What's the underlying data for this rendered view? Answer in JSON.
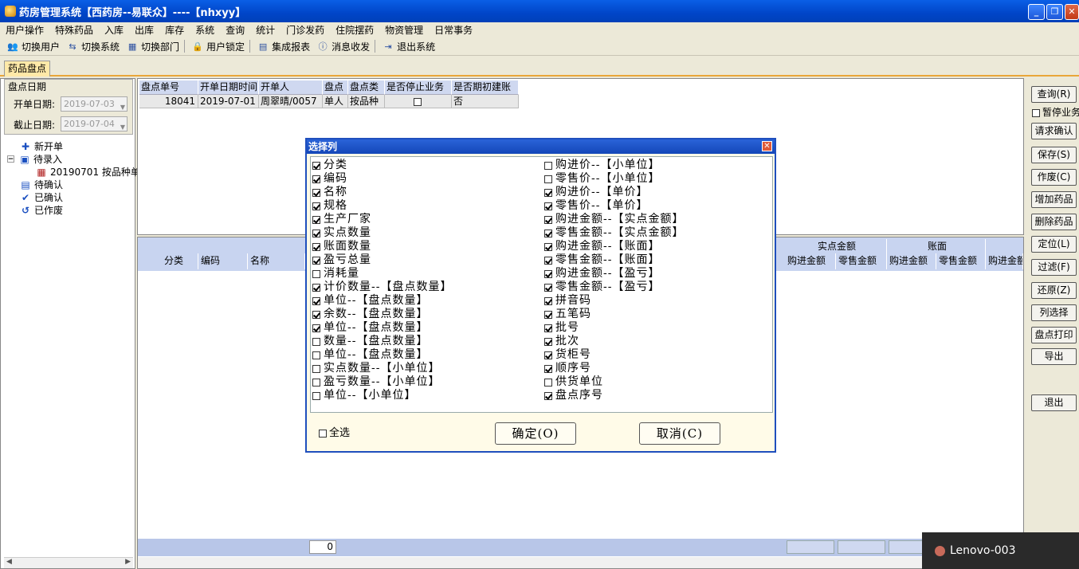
{
  "window": {
    "title": "药房管理系统【西药房--易联众】----【nhxyy】"
  },
  "menu": [
    "用户操作",
    "特殊药品",
    "入库",
    "出库",
    "库存",
    "系统",
    "查询",
    "统计",
    "门诊发药",
    "住院摆药",
    "物资管理",
    "日常事务"
  ],
  "toolbar": [
    {
      "label": "切换用户",
      "icon": "users-icon"
    },
    {
      "label": "切换系统",
      "icon": "switch-system-icon"
    },
    {
      "label": "切换部门",
      "icon": "department-icon"
    },
    {
      "label": "用户锁定",
      "icon": "user-lock-icon"
    },
    {
      "label": "集成报表",
      "icon": "report-icon"
    },
    {
      "label": "消息收发",
      "icon": "message-icon"
    },
    {
      "label": "退出系统",
      "icon": "exit-icon"
    }
  ],
  "tab": "药品盘点",
  "left": {
    "group_title": "盘点日期",
    "start_label": "开单日期:",
    "start_value": "2019-07-03",
    "end_label": "截止日期:",
    "end_value": "2019-07-04",
    "tree": [
      "新开单",
      "待录入",
      "20190701 按品种单",
      "待确认",
      "已确认",
      "已作废"
    ]
  },
  "grid1": {
    "headers": [
      "盘点单号",
      "开单日期时间",
      "开单人",
      "盘点",
      "盘点类",
      "是否停止业务",
      "是否期初建账"
    ],
    "row": [
      "18041",
      "2019-07-01",
      "周翠晴/0057",
      "单人",
      "按品种",
      "",
      "否"
    ]
  },
  "grid2": {
    "headers": [
      "分类",
      "编码",
      "名称"
    ],
    "group_headers": [
      "实点金额",
      "账面"
    ],
    "sub_headers": [
      "购进金额",
      "零售金额",
      "购进金额",
      "零售金额",
      "购进金额"
    ],
    "footer_value": "0"
  },
  "right_buttons": [
    "查询(R)",
    "请求确认",
    "保存(S)",
    "作废(C)",
    "增加药品",
    "删除药品",
    "定位(L)",
    "过滤(F)",
    "还原(Z)",
    "列选择",
    "盘点打印",
    "导出",
    "退出"
  ],
  "pause_label": "暂停业务",
  "dialog": {
    "title": "选择列",
    "left_options": [
      {
        "label": "分类",
        "checked": true
      },
      {
        "label": "编码",
        "checked": true
      },
      {
        "label": "名称",
        "checked": true
      },
      {
        "label": "规格",
        "checked": true
      },
      {
        "label": "生产厂家",
        "checked": true
      },
      {
        "label": "实点数量",
        "checked": true
      },
      {
        "label": "账面数量",
        "checked": true
      },
      {
        "label": "盈亏总量",
        "checked": true
      },
      {
        "label": "消耗量",
        "checked": false
      },
      {
        "label": "计价数量--【盘点数量】",
        "checked": true
      },
      {
        "label": "单位--【盘点数量】",
        "checked": true
      },
      {
        "label": "余数--【盘点数量】",
        "checked": true
      },
      {
        "label": "单位--【盘点数量】",
        "checked": true
      },
      {
        "label": "数量--【盘点数量】",
        "checked": false
      },
      {
        "label": "单位--【盘点数量】",
        "checked": false
      },
      {
        "label": "实点数量--【小单位】",
        "checked": false
      },
      {
        "label": "盈亏数量--【小单位】",
        "checked": false
      },
      {
        "label": "单位--【小单位】",
        "checked": false
      }
    ],
    "right_options": [
      {
        "label": "购进价--【小单位】",
        "checked": false
      },
      {
        "label": "零售价--【小单位】",
        "checked": false
      },
      {
        "label": "购进价--【单价】",
        "checked": true
      },
      {
        "label": "零售价--【单价】",
        "checked": true
      },
      {
        "label": "购进金额--【实点金额】",
        "checked": true
      },
      {
        "label": "零售金额--【实点金额】",
        "checked": true
      },
      {
        "label": "购进金额--【账面】",
        "checked": true
      },
      {
        "label": "零售金额--【账面】",
        "checked": true
      },
      {
        "label": "购进金额--【盈亏】",
        "checked": true
      },
      {
        "label": "零售金额--【盈亏】",
        "checked": true
      },
      {
        "label": "拼音码",
        "checked": true
      },
      {
        "label": "五笔码",
        "checked": true
      },
      {
        "label": "批号",
        "checked": true
      },
      {
        "label": "批次",
        "checked": true
      },
      {
        "label": "货柜号",
        "checked": true
      },
      {
        "label": "顺序号",
        "checked": true
      },
      {
        "label": "供货单位",
        "checked": false
      },
      {
        "label": "盘点序号",
        "checked": true
      }
    ],
    "select_all": "全选",
    "ok": "确定(O)",
    "cancel": "取消(C)"
  },
  "overlay": {
    "label": "Lenovo-003"
  }
}
